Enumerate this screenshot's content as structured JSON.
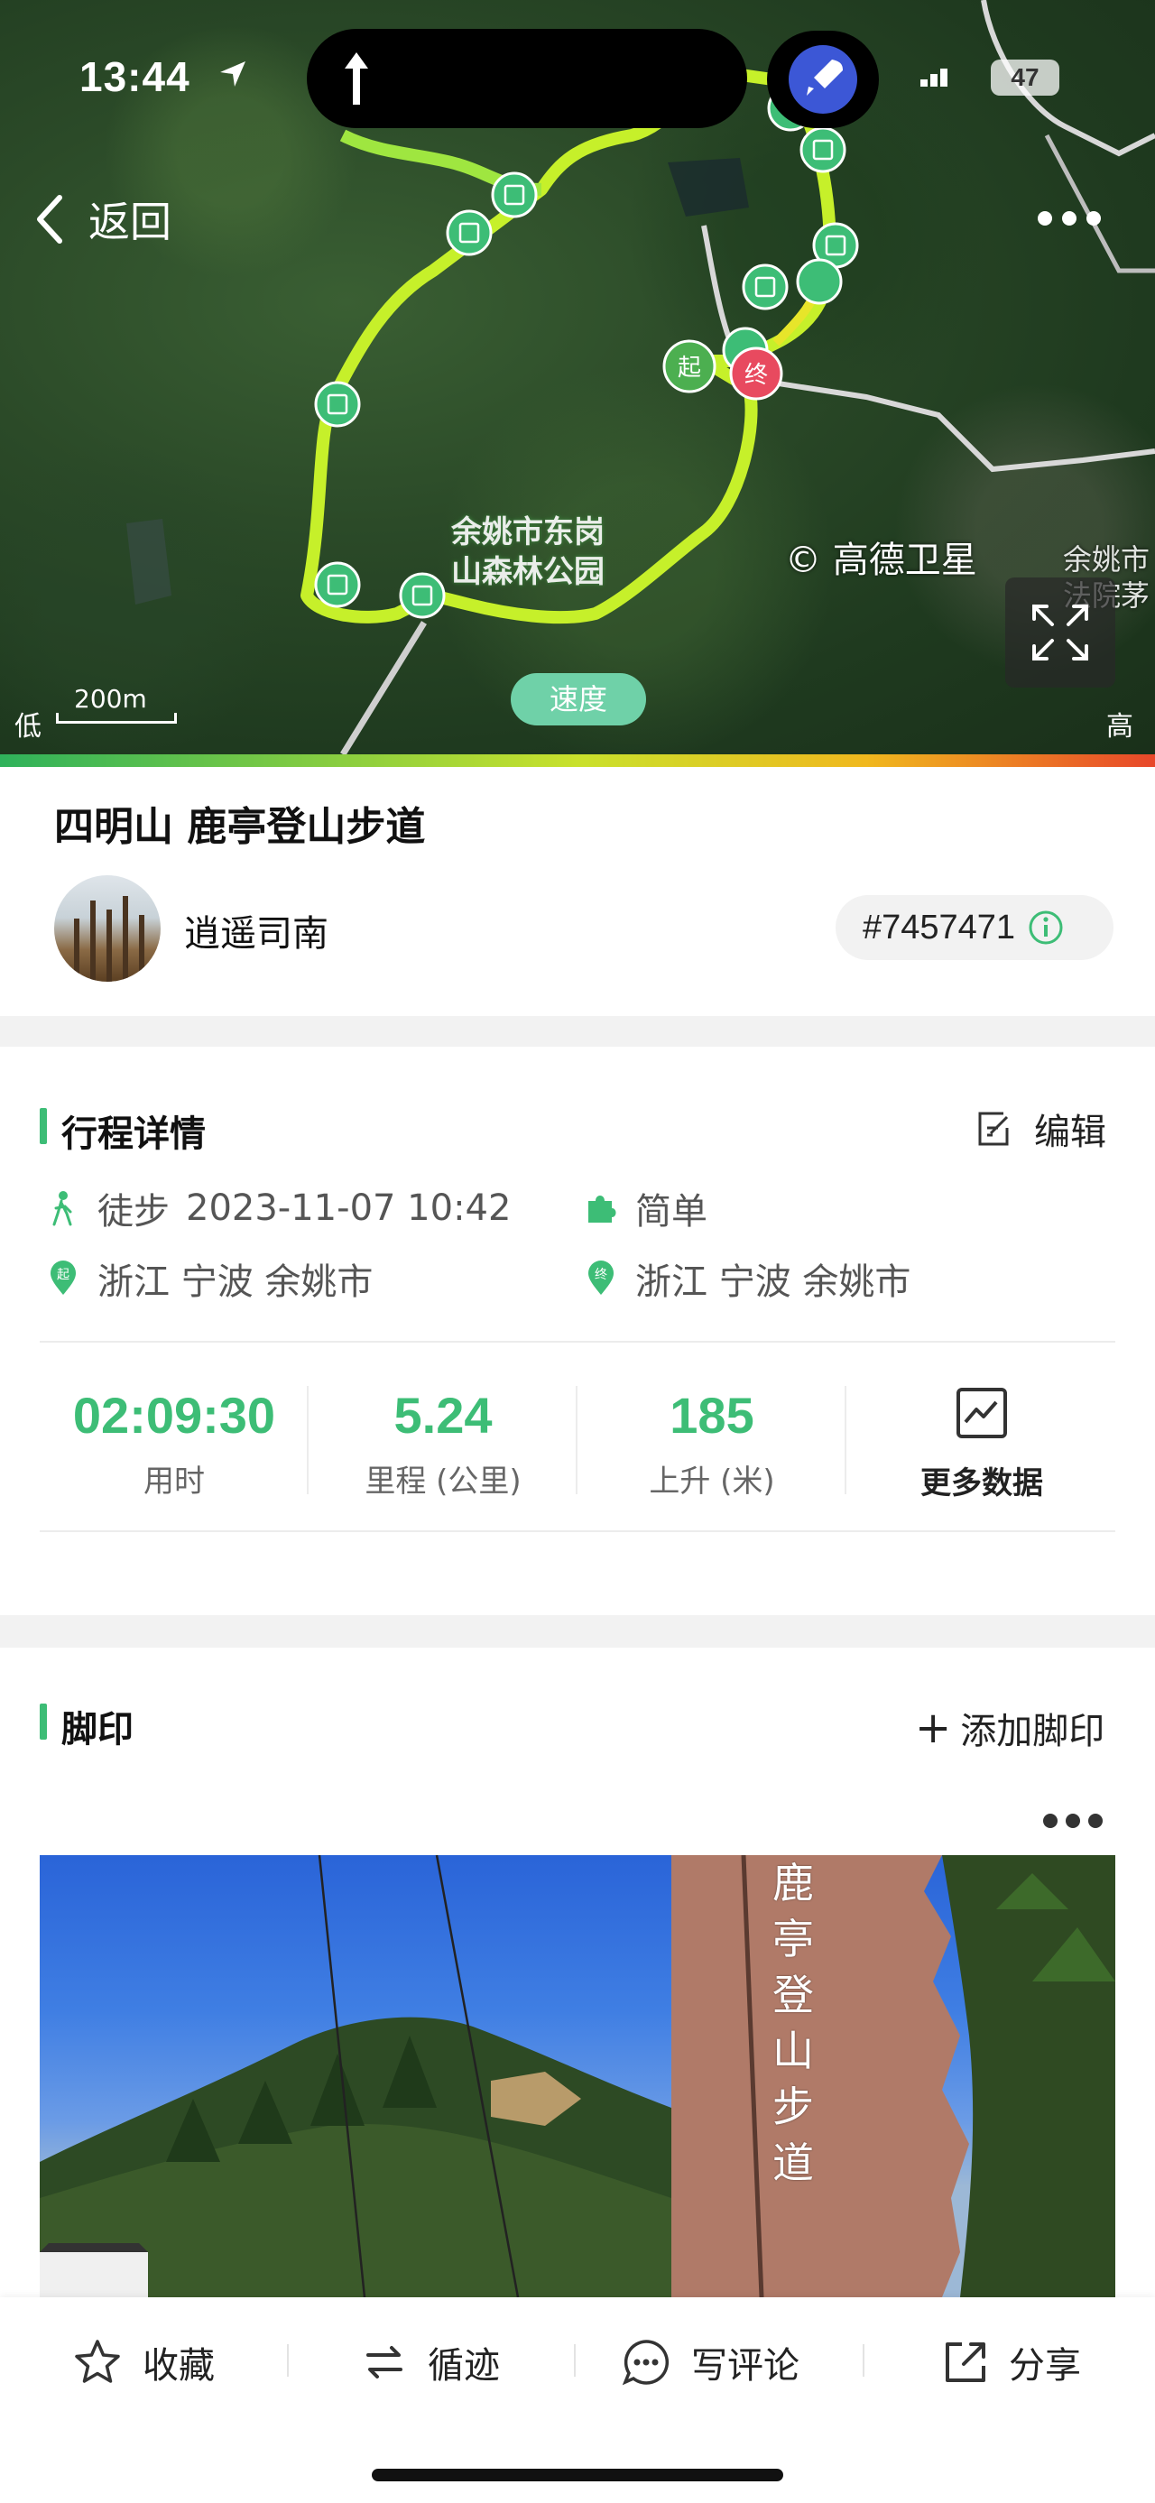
{
  "status_bar": {
    "time": "13:44",
    "battery": "47"
  },
  "map": {
    "back_label": "返回",
    "attribution": "© 高德卫星",
    "park_label_line1": "余姚市东岗",
    "park_label_line2": "山森林公园",
    "city_label_line1": "余姚市",
    "city_label_line2": "法院茅",
    "start_marker": "起",
    "end_marker": "终",
    "speed_button": "速度",
    "scale": "200m",
    "legend_low": "低",
    "legend_high": "高"
  },
  "trail": {
    "title": "四明山 鹿亭登山步道",
    "user_name": "逍遥司南",
    "trail_id": "#7457471"
  },
  "trip": {
    "section_title": "行程详情",
    "edit_label": "编辑",
    "activity": "徒步",
    "datetime": "2023-11-07 10:42",
    "difficulty": "简单",
    "start_place": "浙江 宁波 余姚市",
    "end_place": "浙江 宁波 余姚市",
    "stats": [
      {
        "value": "02:09:30",
        "label": "用时"
      },
      {
        "value": "5.24",
        "label": "里程 (公里)"
      },
      {
        "value": "185",
        "label": "上升 (米)"
      }
    ],
    "more_data_label": "更多数据"
  },
  "footprints": {
    "section_title": "脚印",
    "add_label": "添加脚印",
    "sign_text": "鹿亭登山步道"
  },
  "bottom_bar": {
    "collect": "收藏",
    "follow": "循迹",
    "comment": "写评论",
    "share": "分享"
  },
  "colors": {
    "accent": "#3dbd76",
    "end_marker": "#e84a5f",
    "speed_pill": "#6fd1a8"
  }
}
